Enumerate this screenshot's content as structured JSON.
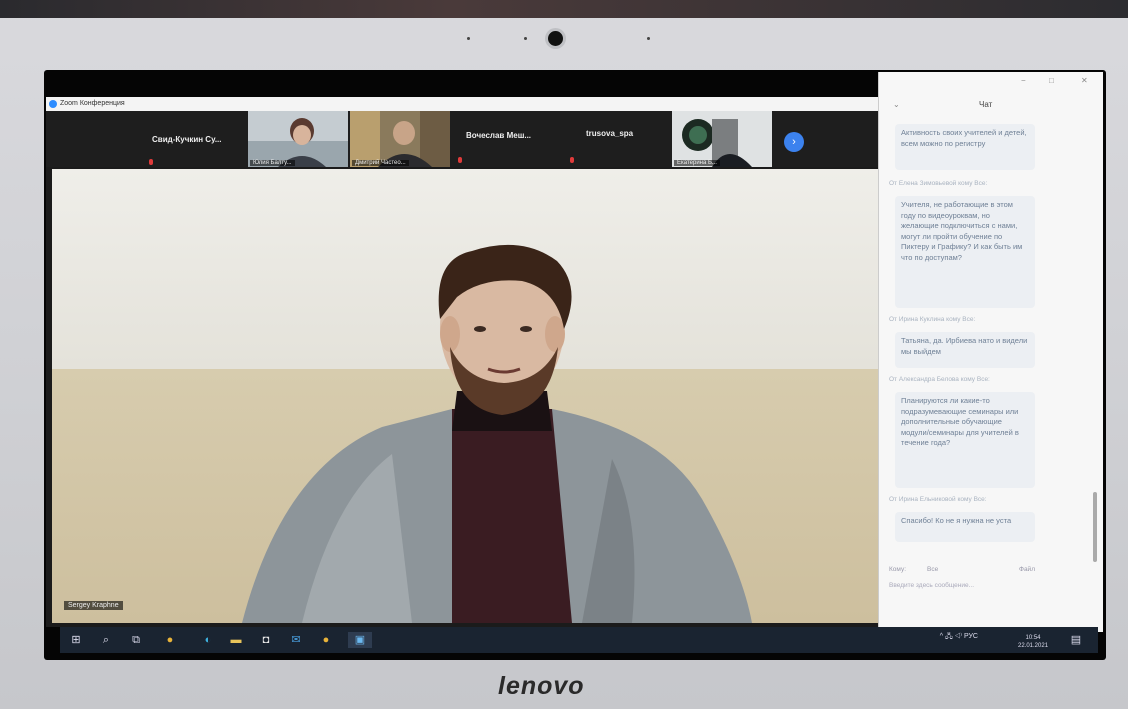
{
  "window": {
    "title": "Zoom Конференция"
  },
  "participants": [
    {
      "name": "Свид-Кучкин  Су...",
      "kind": "name-only"
    },
    {
      "name": "Юлия Балту...",
      "kind": "video"
    },
    {
      "name": "Дмитрий Частео...",
      "kind": "video"
    },
    {
      "name": "Вочеслав  Меш...",
      "kind": "name-only"
    },
    {
      "name": "trusova_spa",
      "kind": "name-only"
    },
    {
      "name": "Екатерина Б...",
      "kind": "video"
    }
  ],
  "strip_nav": {
    "icon": "chevron-right-icon",
    "label": "›"
  },
  "speaker": {
    "label": "Sergey Kraphne"
  },
  "chat": {
    "title": "Чат",
    "window_controls": [
      "−",
      "□",
      "✕"
    ],
    "messages": [
      {
        "sender": "",
        "text": "Активность своих учителей и детей, всем можно по регистру"
      },
      {
        "sender": "От Елена Зимовьевой кому Все:",
        "text": "Учителя, не работающие в этом году по видеоуроквам, но желающие подключиться с нами, могут ли пройти обучение по Пиктеру и Графику? И как быть им что по доступам?"
      },
      {
        "sender": "От Ирина Куклина кому Все:",
        "text": "Татьяна, да. Ирбиева нато и видели мы выйдем"
      },
      {
        "sender": "От Александра Белова кому Все:",
        "text": "Планируются ли какие-то подразумевающие семинары или дополнительные обучающие модули/семинары для учителей в течение года?"
      },
      {
        "sender": "От Ирина Ельниковой кому Все:",
        "text": "Спасибо! Ко не я нужна не уста"
      }
    ],
    "to_label": "Кому:",
    "to_value": "Все",
    "file_label": "Файл",
    "input_placeholder": "Введите здесь сообщение..."
  },
  "taskbar": {
    "icons": [
      "windows-icon",
      "search-icon",
      "taskview-icon",
      "chrome-icon",
      "edge-icon",
      "folder-icon",
      "store-icon",
      "mail-icon",
      "chrome-icon",
      "zoom-icon"
    ],
    "tray": "^ 🖧 ◁⁾ РУС",
    "time": "10:54",
    "date": "22.01.2021"
  },
  "brand": "lenovo",
  "colors": {
    "zoom_blue": "#2d8cff",
    "taskbar": "#1a2431"
  }
}
